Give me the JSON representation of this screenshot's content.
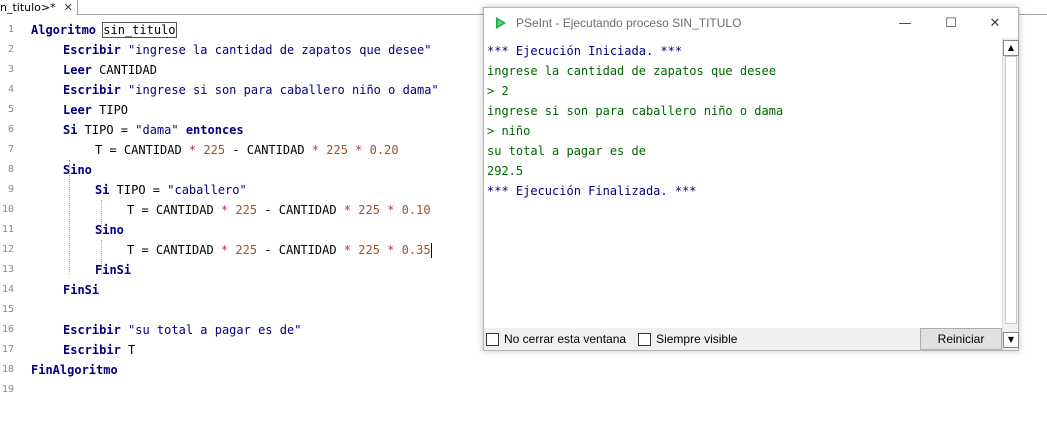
{
  "tab": {
    "label": "n_titulo>*",
    "close": "✕"
  },
  "editor": {
    "lines": [
      {
        "n": "1"
      },
      {
        "n": "2"
      },
      {
        "n": "3"
      },
      {
        "n": "4"
      },
      {
        "n": "5"
      },
      {
        "n": "6"
      },
      {
        "n": "7"
      },
      {
        "n": "8"
      },
      {
        "n": "9"
      },
      {
        "n": "10"
      },
      {
        "n": "11"
      },
      {
        "n": "12"
      },
      {
        "n": "13"
      },
      {
        "n": "14"
      },
      {
        "n": "15"
      },
      {
        "n": "16"
      },
      {
        "n": "17"
      },
      {
        "n": "18"
      },
      {
        "n": "19"
      }
    ],
    "tok": {
      "algoritmo": "Algoritmo",
      "name": "sin_titulo",
      "escribir": "Escribir",
      "leer": "Leer",
      "s1": "\"ingrese la cantidad de zapatos que desee\"",
      "v_cantidad": " CANTIDAD",
      "s2": "\"ingrese si son para caballero niño o dama\"",
      "v_tipo": " TIPO",
      "si": "Si",
      "tipo_eq": " TIPO = ",
      "s_dama": "\"dama\"",
      "entonces": " entonces",
      "t_eq_cant": "T = CANTIDAD ",
      "star": "*",
      "n225": "225",
      "minus_cant": " - CANTIDAD ",
      "n020": "0.20",
      "sino": "Sino",
      "s_caballero": "\"caballero\"",
      "n010": "0.10",
      "n03": "0.3",
      "n5": "5",
      "finsi": "FinSi",
      "s3": "\"su total a pagar es de\"",
      "v_t": " T",
      "finalgoritmo": "FinAlgoritmo"
    }
  },
  "console_window": {
    "title": "PSeInt - Ejecutando proceso SIN_TITULO",
    "minimize": "—",
    "maximize": "☐",
    "close": "✕",
    "lines": [
      {
        "text": "*** Ejecución Iniciada. ***",
        "kind": "info"
      },
      {
        "text": "ingrese la cantidad de zapatos que desee",
        "kind": "out"
      },
      {
        "text": "> 2",
        "kind": "inp"
      },
      {
        "text": "ingrese si son para caballero niño o dama",
        "kind": "out"
      },
      {
        "text": "> niño",
        "kind": "inp"
      },
      {
        "text": "su total a pagar es de",
        "kind": "out"
      },
      {
        "text": "292.5",
        "kind": "out"
      },
      {
        "text": "*** Ejecución Finalizada. ***",
        "kind": "info"
      }
    ],
    "checkbox_no_cerrar": "No cerrar esta ventana",
    "checkbox_siempre_visible": "Siempre visible",
    "reset_button": "Reiniciar",
    "scroll_up": "▲",
    "scroll_down": "▼"
  }
}
